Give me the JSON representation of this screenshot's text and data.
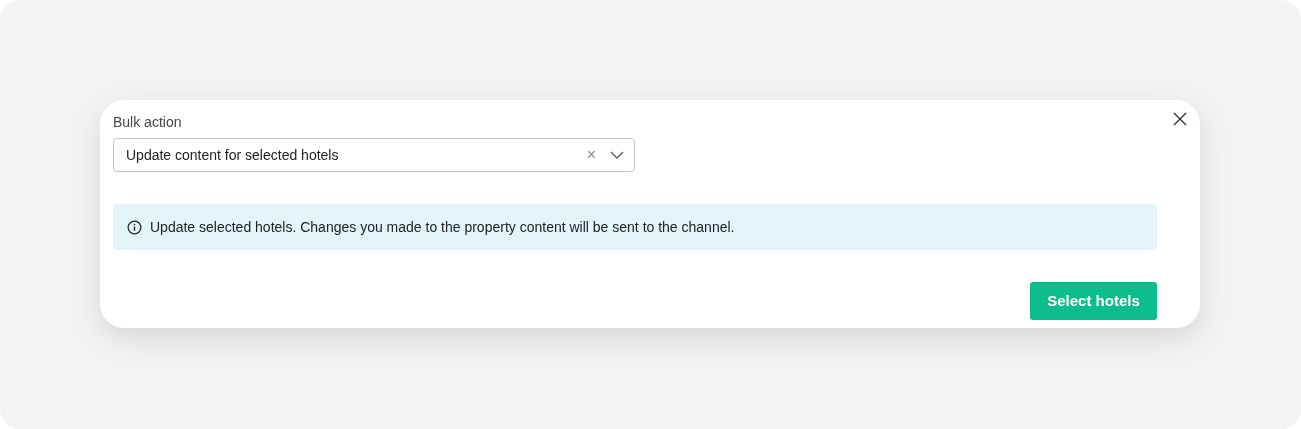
{
  "dialog": {
    "field_label": "Bulk action",
    "select": {
      "value": "Update content for selected hotels",
      "clear_glyph": "×"
    },
    "info": "Update selected hotels. Changes you made to the property content will be sent to the channel.",
    "primary_button": "Select hotels"
  }
}
